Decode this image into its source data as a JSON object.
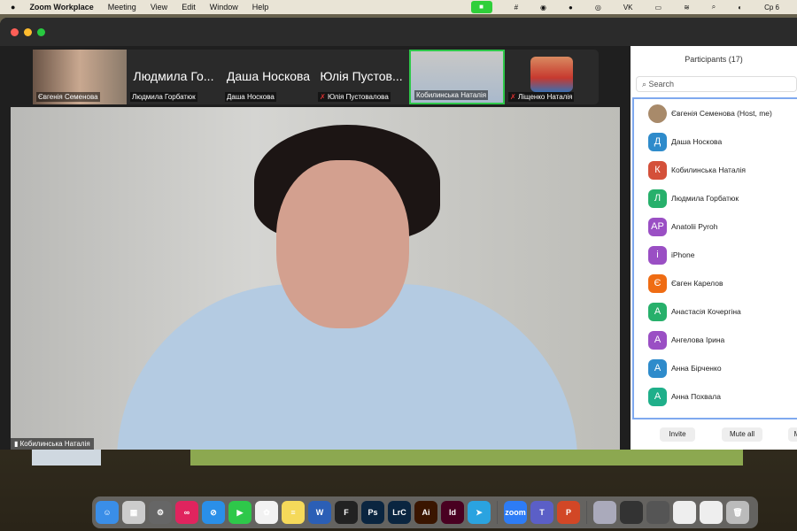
{
  "menubar": {
    "app": "Zoom Workplace",
    "items": [
      "Meeting",
      "View",
      "Edit",
      "Window",
      "Help"
    ],
    "clock": "Ср 6"
  },
  "thumbs": [
    {
      "name": "Євгенія Семенова",
      "big": ""
    },
    {
      "name": "Людмила Горбатюк",
      "big": "Людмила Го..."
    },
    {
      "name": "Даша Носкова",
      "big": "Даша Носкова"
    },
    {
      "name": "Юлія Пустовалова",
      "big": "Юлія Пустов..."
    },
    {
      "name": "Кобилинська Наталія",
      "big": ""
    },
    {
      "name": "Ліщенко Наталія",
      "big": ""
    }
  ],
  "main": {
    "name": "Кобилинська Наталія"
  },
  "participants": {
    "title": "Participants (17)",
    "search_placeholder": "Search",
    "list": [
      {
        "name": "Євгенія Семенова (Host, me)",
        "initial": "",
        "color": "#a88a6a"
      },
      {
        "name": "Даша Носкова",
        "initial": "Д",
        "color": "#2e8bcb"
      },
      {
        "name": "Кобилинська Наталія",
        "initial": "К",
        "color": "#d4503a"
      },
      {
        "name": "Людмила Горбатюк",
        "initial": "Л",
        "color": "#27b06b"
      },
      {
        "name": "Anatolii Pyroh",
        "initial": "AP",
        "color": "#9a4fc4"
      },
      {
        "name": "iPhone",
        "initial": "i",
        "color": "#9a4fc4"
      },
      {
        "name": "Євген Карелов",
        "initial": "Є",
        "color": "#ef6c13"
      },
      {
        "name": "Анастасія Кочергіна",
        "initial": "А",
        "color": "#27b06b"
      },
      {
        "name": "Ангелова Ірина",
        "initial": "А",
        "color": "#9a4fc4"
      },
      {
        "name": "Анна Бірченко",
        "initial": "А",
        "color": "#2e8bcb"
      },
      {
        "name": "Анна Похвала",
        "initial": "А",
        "color": "#1faf8a"
      }
    ],
    "invite": "Invite",
    "mute_all": "Mute all",
    "more": "M"
  },
  "dock": [
    {
      "n": "finder",
      "l": "☺",
      "c": "#3a8ee8"
    },
    {
      "n": "launchpad",
      "l": "▦",
      "c": "#ccc"
    },
    {
      "n": "settings",
      "l": "⚙",
      "c": "#666"
    },
    {
      "n": "creative-cloud",
      "l": "∞",
      "c": "#e0245e"
    },
    {
      "n": "safari",
      "l": "⊘",
      "c": "#2a8fe8"
    },
    {
      "n": "facetime",
      "l": "▶",
      "c": "#2ec84a"
    },
    {
      "n": "photos",
      "l": "✿",
      "c": "#f2f2f2"
    },
    {
      "n": "notes",
      "l": "≡",
      "c": "#f5d95a"
    },
    {
      "n": "word",
      "l": "W",
      "c": "#2b5fb6"
    },
    {
      "n": "figma",
      "l": "F",
      "c": "#222"
    },
    {
      "n": "photoshop",
      "l": "Ps",
      "c": "#0a2540"
    },
    {
      "n": "lightroom",
      "l": "LrC",
      "c": "#0a2540"
    },
    {
      "n": "illustrator",
      "l": "Ai",
      "c": "#3a1500"
    },
    {
      "n": "indesign",
      "l": "Id",
      "c": "#490021"
    },
    {
      "n": "telegram",
      "l": "➤",
      "c": "#2aa3e0"
    },
    {
      "n": "sep"
    },
    {
      "n": "zoom",
      "l": "zoom",
      "c": "#2d7cf6"
    },
    {
      "n": "teams",
      "l": "T",
      "c": "#5b5fc7"
    },
    {
      "n": "powerpoint",
      "l": "P",
      "c": "#d24726"
    },
    {
      "n": "sep"
    },
    {
      "n": "window-1",
      "l": "",
      "c": "#aab"
    },
    {
      "n": "window-2",
      "l": "",
      "c": "#333"
    },
    {
      "n": "window-3",
      "l": "",
      "c": "#555"
    },
    {
      "n": "window-4",
      "l": "",
      "c": "#eee"
    },
    {
      "n": "window-5",
      "l": "",
      "c": "#eee"
    },
    {
      "n": "trash",
      "l": "🗑",
      "c": "#bbb"
    }
  ]
}
